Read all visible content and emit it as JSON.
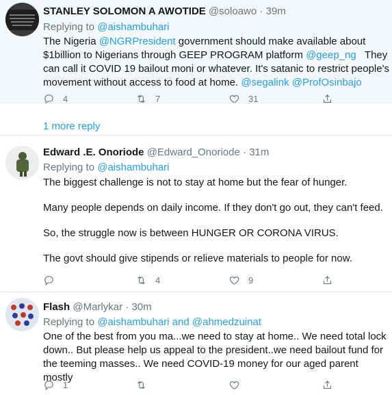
{
  "tweets": [
    {
      "name": "STANLEY SOLOMON A AWOTIDE",
      "handle": "@soloawo",
      "sep": "·",
      "time": "39m",
      "replying_prefix": "Replying to ",
      "replying_to": "@aishambuhari",
      "lines": [
        [
          "The Nigeria ",
          "@NGRPresident",
          " government should make available about"
        ],
        [
          "$1billion to Nigerians through GEEP PROGRAM platform ",
          "@geep_ng",
          "   They"
        ],
        [
          "can call it COVID 19 bailout moni or whatever. It's satanic to restrict people's"
        ],
        [
          "movement without access to food at home. ",
          "@segalink",
          " ",
          "@ProfOsinbajo"
        ]
      ],
      "replies": "4",
      "retweets": "7",
      "likes": "31"
    },
    {
      "name": "Edward .E. Onoriode",
      "handle": "@Edward_Onoriode",
      "sep": "·",
      "time": "31m",
      "replying_prefix": "Replying to ",
      "replying_to": "@aishambuhari",
      "paragraphs": [
        "The biggest challenge is not to stay at home but the fear of hunger.",
        "Many people depends on daily income. If they don't go out, they can't feed.",
        "So, the struggle now is between HUNGER OR CORONA VIRUS.",
        "The govt should give stipends or relieve materials to people for now."
      ],
      "replies": "",
      "retweets": "4",
      "likes": "9"
    },
    {
      "name": "Flash",
      "handle": "@Marlykar",
      "sep": "·",
      "time": "30m",
      "replying_prefix": "Replying to ",
      "replying_to": "@aishambuhari",
      "replying_and": " and ",
      "replying_to_2": "@ahmedzuinat",
      "lines_plain": [
        "One of the best from you ma...we need to stay at home.. We need total lock",
        "down.. But please help us appeal to the president..we need bailout fund for",
        "the teeming masses.. We need COVID-19 money for our aged parent mostly"
      ],
      "replies": "1",
      "retweets": "",
      "likes": ""
    }
  ],
  "more_reply": "1 more reply",
  "avatar_1_text": "Glory, wealth, they are to be attained"
}
